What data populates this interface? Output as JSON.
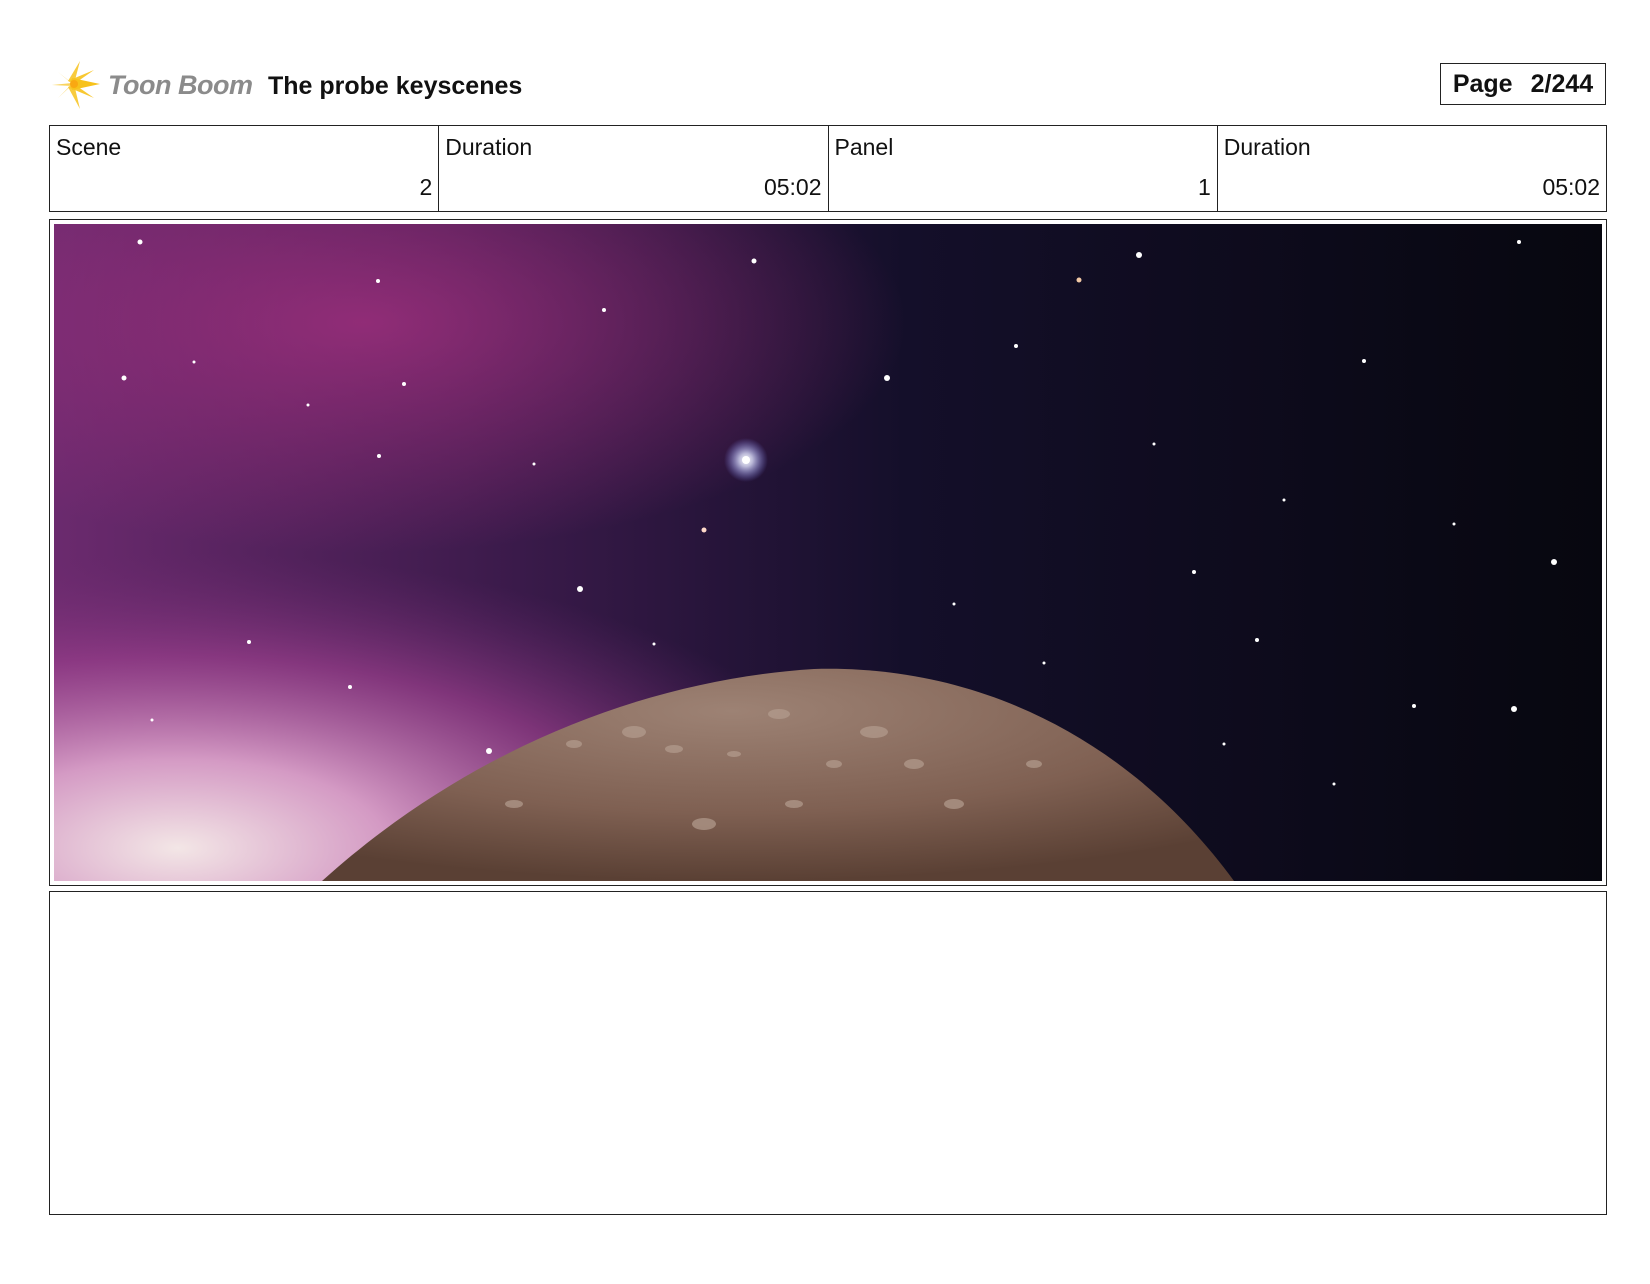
{
  "header": {
    "brand": "Toon Boom",
    "title": "The probe keyscenes",
    "page_label": "Page",
    "page_number": "2/244"
  },
  "info": [
    {
      "label": "Scene",
      "value": "2"
    },
    {
      "label": "Duration",
      "value": "05:02"
    },
    {
      "label": "Panel",
      "value": "1"
    },
    {
      "label": "Duration",
      "value": "05:02"
    }
  ],
  "colors": {
    "logo_yellow": "#f7c21b",
    "nebula": "#8e2c8a",
    "space": "#0b0b1c",
    "planet": "#8a6c5c"
  },
  "icons": {
    "logo": "starburst-logo-icon"
  }
}
